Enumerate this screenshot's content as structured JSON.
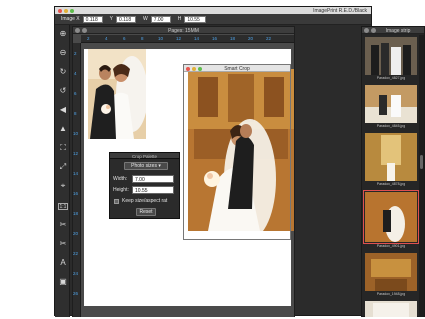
{
  "app": {
    "title": "ImagePrint R.E.D./Black"
  },
  "toolbar": {
    "image_x_label": "Image X",
    "image_x_value": "0.118",
    "y_label": "Y",
    "y_value": "0.118",
    "w_label": "W",
    "w_value": "7.00",
    "h_label": "H",
    "h_value": "10.55"
  },
  "pages_window": {
    "title": "Pages: 15MM",
    "ruler_top": [
      "2",
      "4",
      "6",
      "8",
      "10",
      "12",
      "14",
      "16",
      "18",
      "20",
      "22"
    ],
    "ruler_left": [
      "2",
      "4",
      "6",
      "8",
      "10",
      "12",
      "14",
      "16",
      "18",
      "20",
      "22",
      "24",
      "26"
    ]
  },
  "smart_crop": {
    "title": "Smart Crop"
  },
  "crop_palette": {
    "title": "Crop Palette",
    "preset_value": "Photo sizes",
    "width_label": "Width:",
    "width_value": "7.00",
    "height_label": "Height:",
    "height_value": "10.55",
    "keep_ratio_label": "Keep size/aspect rat",
    "reset_label": "Reset"
  },
  "image_strip": {
    "title": "Image strip",
    "items": [
      {
        "name": "Paradox_4827.jpg",
        "selected": false
      },
      {
        "name": "Paradox_4845.jpg",
        "selected": false
      },
      {
        "name": "Paradox_4878.jpg",
        "selected": false
      },
      {
        "name": "Paradox_4901.jpg",
        "selected": true
      },
      {
        "name": "Paradox_1948.jpg",
        "selected": false
      }
    ]
  },
  "tools": [
    "zoom-in-icon",
    "zoom-out-icon",
    "rotate-cw-icon",
    "rotate-ccw-icon",
    "flip-icon",
    "mirror-icon",
    "crop-icon",
    "fit-icon",
    "center-icon",
    "one-to-one-icon",
    "split-h-icon",
    "split-v-icon",
    "text-icon",
    "color-icon"
  ],
  "colors": {
    "accent_ruler": "#4fa3e8",
    "selected_outline": "#e05050",
    "panel_bg": "#2b2b2b"
  }
}
